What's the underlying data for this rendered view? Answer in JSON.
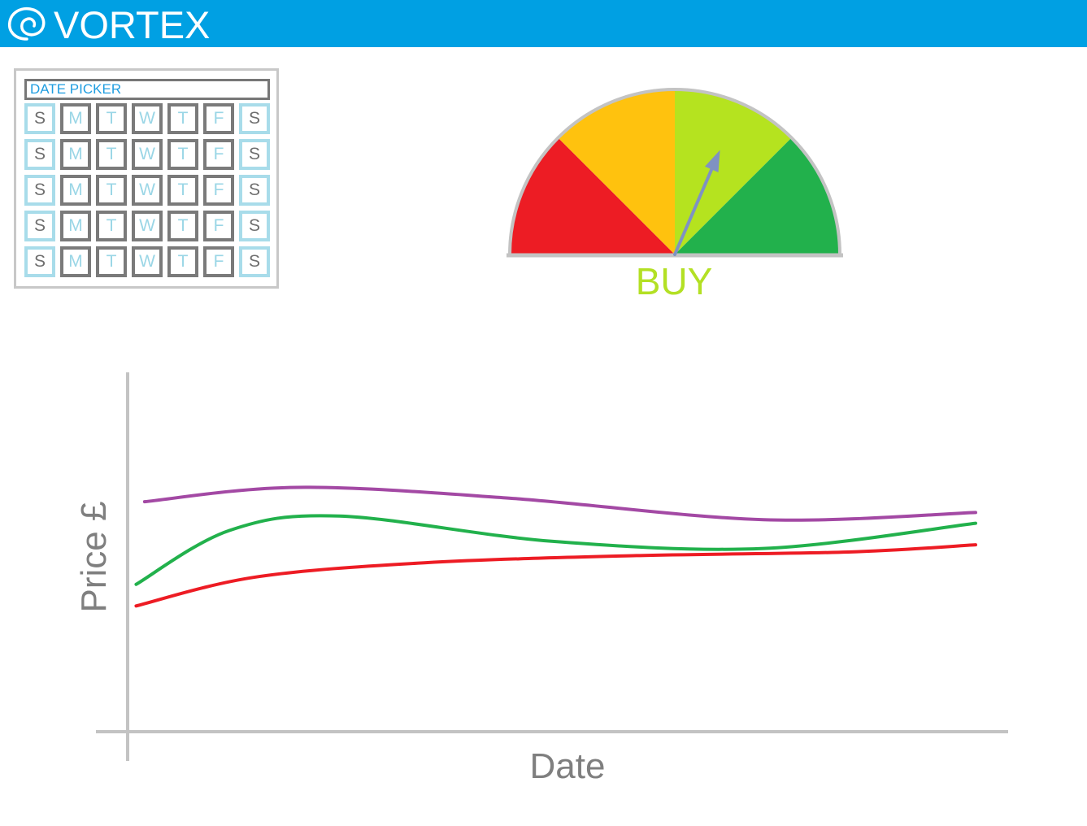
{
  "app": {
    "brand": "VORTEX",
    "logo_icon": "swirl-icon",
    "header_color": "#00a0e3"
  },
  "date_picker": {
    "title": "DATE PICKER",
    "days": [
      "S",
      "M",
      "T",
      "W",
      "T",
      "F",
      "S"
    ],
    "rows": 5
  },
  "gauge": {
    "label": "BUY",
    "label_color": "#b3e024",
    "segments": [
      {
        "name": "red",
        "color": "#ed1c24"
      },
      {
        "name": "amber",
        "color": "#ffc20e"
      },
      {
        "name": "light-green",
        "color": "#b5e31f"
      },
      {
        "name": "green",
        "color": "#22b14c"
      }
    ],
    "needle_color": "#7f92c2",
    "needle_level": 0.63
  },
  "chart_data": {
    "type": "line",
    "xlabel": "Date",
    "ylabel": "Price £",
    "grid": false,
    "legend": "none",
    "xlim": [
      0,
      100
    ],
    "ylim": [
      0,
      100
    ],
    "series": [
      {
        "color": "#a349a4",
        "x": [
          2,
          20,
          45,
          75,
          100
        ],
        "values": [
          64,
          68,
          65,
          59,
          61
        ]
      },
      {
        "color": "#22b14c",
        "x": [
          1,
          12,
          25,
          50,
          75,
          100
        ],
        "values": [
          41,
          56,
          60,
          53,
          51,
          58
        ]
      },
      {
        "color": "#ed1c24",
        "x": [
          1,
          15,
          35,
          60,
          85,
          100
        ],
        "values": [
          35,
          43,
          47,
          49,
          50,
          52
        ]
      }
    ]
  }
}
